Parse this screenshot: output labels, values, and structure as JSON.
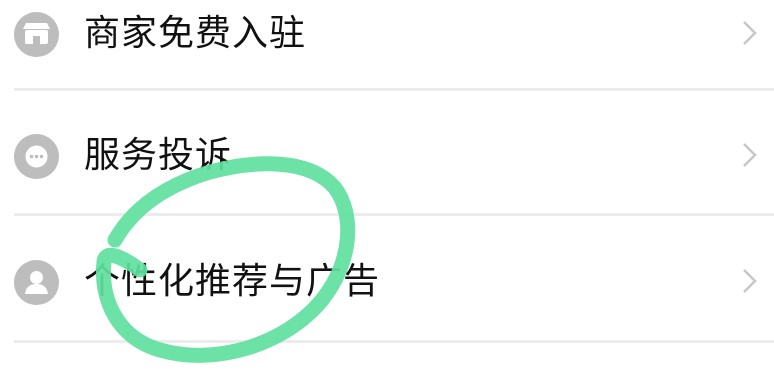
{
  "menu": {
    "items": [
      {
        "label": "商家免费入驻",
        "icon": "shop-icon"
      },
      {
        "label": "服务投诉",
        "icon": "chat-bubble-icon"
      },
      {
        "label": "个性化推荐与广告",
        "icon": "user-icon"
      }
    ],
    "chevron_icon": "chevron-right-icon"
  },
  "colors": {
    "icon_background": "#bdbdbd",
    "text": "#111111",
    "chevron": "#c7c7c7",
    "divider": "#ececec",
    "annotation_stroke": "#5fe0a0"
  }
}
